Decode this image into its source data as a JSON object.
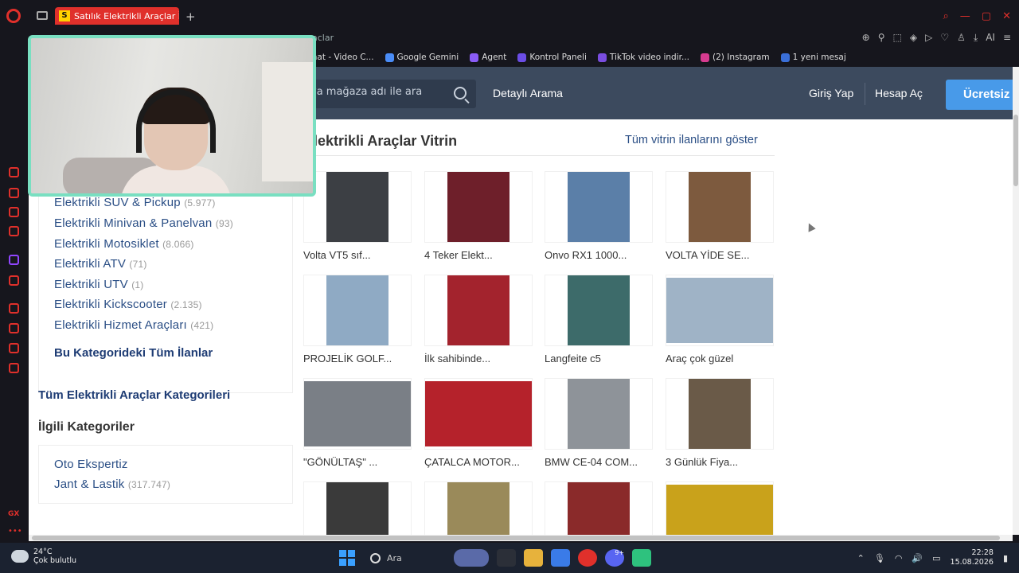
{
  "browser": {
    "tab_title": "Satılık Elektrikli Araçlar İlan",
    "tab_favicon_letter": "S",
    "address_fragment": "aclar",
    "ai_label": "AI",
    "bookmarks": [
      {
        "label": "chat - Video C..."
      },
      {
        "label": "Google Gemini",
        "color": "#4a8cf7"
      },
      {
        "label": "Agent",
        "color": "#8a5cf6"
      },
      {
        "label": "Kontrol Paneli",
        "color": "#6b4de6"
      },
      {
        "label": "TikTok video indir...",
        "color": "#7a4de0"
      },
      {
        "label": "(2) Instagram",
        "color": "#d63b8f"
      },
      {
        "label": "1 yeni mesaj",
        "color": "#3a6fd8"
      }
    ]
  },
  "site_header": {
    "search_placeholder": "eya mağaza adı ile ara",
    "detailed_search": "Detaylı Arama",
    "login": "Giriş Yap",
    "register": "Hesap Aç",
    "cta": "Ücretsiz"
  },
  "categories": {
    "items": [
      {
        "name": "Elektrikli SUV & Pickup",
        "count": "(5.977)"
      },
      {
        "name": "Elektrikli Minivan & Panelvan",
        "count": "(93)"
      },
      {
        "name": "Elektrikli Motosiklet",
        "count": "(8.066)"
      },
      {
        "name": "Elektrikli ATV",
        "count": "(71)"
      },
      {
        "name": "Elektrikli UTV",
        "count": "(1)"
      },
      {
        "name": "Elektrikli Kickscooter",
        "count": "(2.135)"
      },
      {
        "name": "Elektrikli Hizmet Araçları",
        "count": "(421)"
      }
    ],
    "all_in_category": "Bu Kategorideki Tüm İlanlar",
    "all_categories": "Tüm Elektrikli Araçlar Kategorileri",
    "related_title": "İlgili Kategoriler",
    "related": [
      {
        "name": "Oto Ekspertiz",
        "count": ""
      },
      {
        "name": "Jant & Lastik",
        "count": "(317.747)"
      }
    ]
  },
  "vitrin": {
    "title": "Elektrikli Araçlar Vitrin",
    "show_all": "Tüm vitrin ilanlarını göster",
    "listings": [
      {
        "label": "Volta VT5 sıf...",
        "color": "#3c3f44"
      },
      {
        "label": "4 Teker Elekt...",
        "color": "#6e1f2a"
      },
      {
        "label": "Onvo RX1 1000...",
        "color": "#5b7fa8"
      },
      {
        "label": "VOLTA YİDE SE...",
        "color": "#7d5a3e"
      },
      {
        "label": "PROJELİK GOLF...",
        "color": "#8faac4"
      },
      {
        "label": "İlk sahibinde...",
        "color": "#a3232d"
      },
      {
        "label": "Langfeite c5",
        "color": "#3d6b6a"
      },
      {
        "label": "Araç çok güzel",
        "color": "#9fb3c6"
      },
      {
        "label": "\"GÖNÜLTAŞ\" ...",
        "color": "#7a7f86"
      },
      {
        "label": "ÇATALCA MOTOR...",
        "color": "#b5222b"
      },
      {
        "label": "BMW CE-04 COM...",
        "color": "#8e9399"
      },
      {
        "label": "3 Günlük Fiya...",
        "color": "#6a5a48"
      },
      {
        "label": "",
        "color": "#3a3a3a"
      },
      {
        "label": "",
        "color": "#9a8a5a"
      },
      {
        "label": "",
        "color": "#8a2a2a"
      },
      {
        "label": "",
        "color": "#c9a21b"
      }
    ]
  },
  "taskbar": {
    "temperature": "24°C",
    "weather": "Çok bulutlu",
    "search": "Ara",
    "time": "22:28",
    "date": "15.08.2026",
    "badge": "9+"
  }
}
